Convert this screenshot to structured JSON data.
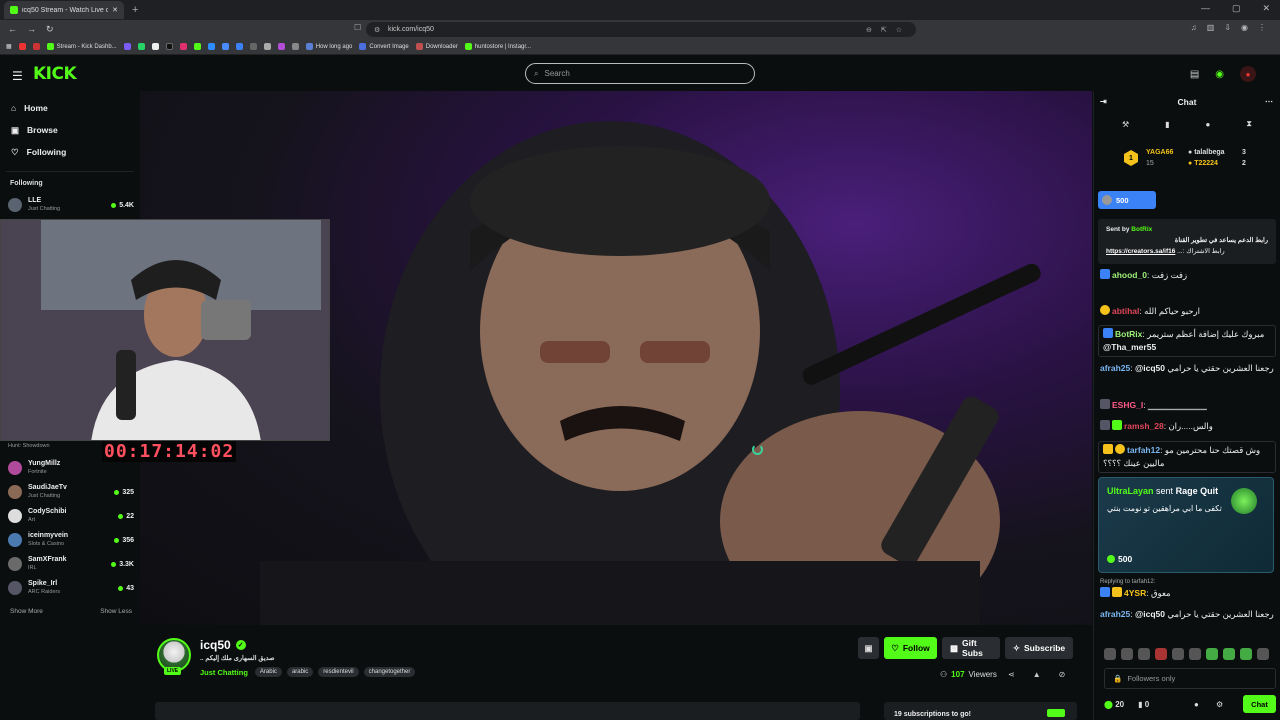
{
  "browser": {
    "tab_title": "icq50 Stream - Watch Live on Ki",
    "url": "kick.com/icq50",
    "bookmarks": [
      "Stream - Kick Dashb...",
      "How long ago",
      "Convert Image",
      "Downloader",
      "huntostore | Instagr..."
    ]
  },
  "kick": {
    "logo": "KICK",
    "search_placeholder": "Search"
  },
  "sidebar": {
    "nav": [
      {
        "label": "Home",
        "icon": "home-icon"
      },
      {
        "label": "Browse",
        "icon": "browse-icon"
      },
      {
        "label": "Following",
        "icon": "heart-icon"
      }
    ],
    "following_header": "Following",
    "channels": [
      {
        "name": "LLE",
        "category": "Just Chatting",
        "viewers": "5.4K"
      },
      {
        "name": "",
        "category": "Hunt: Showdown",
        "viewers": ""
      },
      {
        "name": "YungMillz",
        "category": "Fortnite",
        "viewers": ""
      },
      {
        "name": "SaudiJaeTv",
        "category": "Just Chatting",
        "viewers": "325"
      },
      {
        "name": "CodySchibi",
        "category": "Art",
        "viewers": "22"
      },
      {
        "name": "iceinmyvein",
        "category": "Slots & Casino",
        "viewers": "356"
      },
      {
        "name": "SamXFrank",
        "category": "IRL",
        "viewers": "3.3K"
      },
      {
        "name": "Spike_Irl",
        "category": "ARC Raiders",
        "viewers": "43"
      }
    ],
    "show_more": "Show More",
    "show_less": "Show Less"
  },
  "video": {
    "timer": "00:17:14:02"
  },
  "stream": {
    "streamer": "icq50",
    "live": "LIVE",
    "title": "صديق السهارى ملك إليكم ..",
    "category": "Just Chatting",
    "tags": [
      "Arabic",
      "arabic",
      "resdientevil",
      "changetogether"
    ],
    "follow": "Follow",
    "gift_subs": "Gift Subs",
    "subscribe": "Subscribe",
    "viewers_count": "107",
    "viewers_label": "Viewers",
    "sub_goal": "19 subscriptions to go!"
  },
  "chat": {
    "title": "Chat",
    "leaderboard": [
      {
        "name": "YAGA66",
        "count": "15"
      },
      {
        "name": "talalbega",
        "count": "3"
      },
      {
        "name": "T22224",
        "count": "2"
      }
    ],
    "pinned_points": "500",
    "sent_by_label": "Sent by",
    "sent_by_user": "BotRix",
    "sent_by_text": "رابط الدعم يساعد في تطوير القناة",
    "sent_by_link": "https://creators.sa/if16",
    "sent_by_link_suffix": "رابط الاشتراك :...",
    "messages": [
      {
        "user": "ahood_0",
        "color": "#9ef27a",
        "text": "زفت زفت"
      },
      {
        "user": "abtihal",
        "color": "#e0475a",
        "text": "ارحبو حياكم الله"
      },
      {
        "user": "BotRix",
        "color": "#9ef27a",
        "text": "مبروك عليك إضافة أعظم ستريمر",
        "mention": "@Tha_mer55"
      },
      {
        "user": "afrah25",
        "color": "#7ab7f2",
        "text": "رجعنا العشرين حقتي يا حرامي",
        "mention": "@icq50"
      },
      {
        "user": "ESHG_I",
        "color": "#ff5a8a",
        "text": ""
      },
      {
        "user": "ramsh_28",
        "color": "#e0475a",
        "text": "والس.....ران"
      },
      {
        "user": "tarfah12",
        "color": "#7ab7f2",
        "text": "وش قصتك حنا محترمين مو ماليين عينك ؟؟؟؟"
      },
      {
        "user": "4YSR",
        "color": "#f4c21b",
        "text": "معوق",
        "reply": "Replying to tarfah12:"
      },
      {
        "user": "afrah25",
        "color": "#7ab7f2",
        "text": "رجعنا العشرين حقتي يا حرامي",
        "mention": "@icq50"
      }
    ],
    "gift": {
      "user": "UltraLayan",
      "sent": "sent",
      "item": "Rage Quit",
      "text": "تكفى ما ابي مراهقين تو نومت بنتي",
      "points": "500"
    },
    "input_placeholder": "Followers only",
    "points": "20",
    "zero": "0",
    "chat_button": "Chat"
  }
}
